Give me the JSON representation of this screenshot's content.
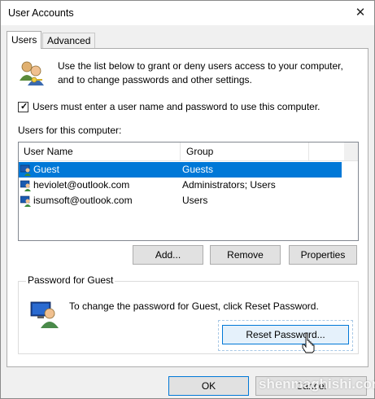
{
  "window": {
    "title": "User Accounts"
  },
  "tabs": [
    {
      "label": "Users"
    },
    {
      "label": "Advanced"
    }
  ],
  "intro_text": "Use the list below to grant or deny users access to your computer, and to change passwords and other settings.",
  "require_login": {
    "label": "Users must enter a user name and password to use this computer.",
    "checked": true
  },
  "users_section_label": "Users for this computer:",
  "table": {
    "columns": [
      "User Name",
      "Group"
    ],
    "rows": [
      {
        "name": "Guest",
        "group": "Guests",
        "selected": true
      },
      {
        "name": "heviolet@outlook.com",
        "group": "Administrators; Users",
        "selected": false
      },
      {
        "name": "isumsoft@outlook.com",
        "group": "Users",
        "selected": false
      }
    ]
  },
  "list_buttons": {
    "add": "Add...",
    "remove": "Remove",
    "properties": "Properties"
  },
  "password_group": {
    "title": "Password for Guest",
    "text": "To change the password for Guest, click Reset Password.",
    "reset_label": "Reset Password..."
  },
  "footer": {
    "ok": "OK",
    "cancel": "Cancel"
  },
  "watermark": "shenmaghishi.com",
  "colors": {
    "selection": "#0078d7",
    "focus_border": "#0078d7"
  }
}
